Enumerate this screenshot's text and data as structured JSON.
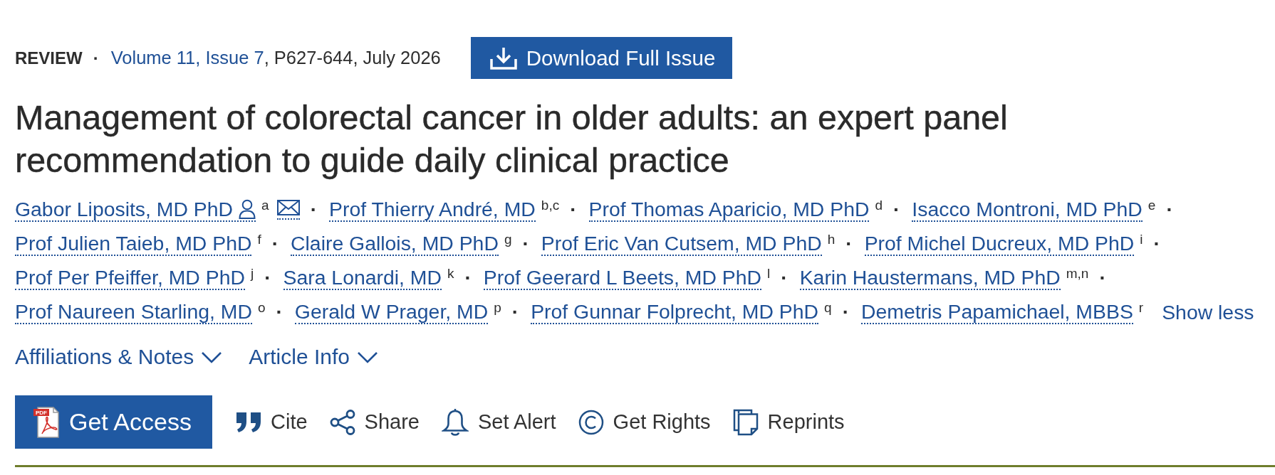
{
  "header": {
    "article_type": "REVIEW",
    "separator": "·",
    "issue_link": "Volume 11, Issue 7",
    "pages_date": ", P627-644, July 2026",
    "download_button": "Download Full Issue"
  },
  "title": "Management of colorectal cancer in older adults: an expert panel recommendation to guide daily clinical practice",
  "authors": [
    {
      "name": "Gabor Liposits, MD PhD",
      "affiliations": "a",
      "corresponding": true,
      "separator": "·"
    },
    {
      "name": "Prof Thierry André, MD",
      "affiliations": "b,c",
      "corresponding": false,
      "separator": "·"
    },
    {
      "name": "Prof Thomas Aparicio, MD PhD",
      "affiliations": "d",
      "corresponding": false,
      "separator": "·"
    },
    {
      "name": "Isacco Montroni, MD PhD",
      "affiliations": "e",
      "corresponding": false,
      "separator": "·"
    },
    {
      "name": "Prof Julien Taieb, MD PhD",
      "affiliations": "f",
      "corresponding": false,
      "separator": "·"
    },
    {
      "name": "Claire Gallois, MD PhD",
      "affiliations": "g",
      "corresponding": false,
      "separator": "·"
    },
    {
      "name": "Prof Eric Van Cutsem, MD PhD",
      "affiliations": "h",
      "corresponding": false,
      "separator": "·"
    },
    {
      "name": "Prof Michel Ducreux, MD PhD",
      "affiliations": "i",
      "corresponding": false,
      "separator": "·"
    },
    {
      "name": "Prof Per Pfeiffer, MD PhD",
      "affiliations": "j",
      "corresponding": false,
      "separator": "·"
    },
    {
      "name": "Sara Lonardi, MD",
      "affiliations": "k",
      "corresponding": false,
      "separator": "·"
    },
    {
      "name": "Prof Geerard L Beets, MD PhD",
      "affiliations": "l",
      "corresponding": false,
      "separator": "·"
    },
    {
      "name": "Karin Haustermans, MD PhD",
      "affiliations": "m,n",
      "corresponding": false,
      "separator": "·"
    },
    {
      "name": "Prof Naureen Starling, MD",
      "affiliations": "o",
      "corresponding": false,
      "separator": "·"
    },
    {
      "name": "Gerald W Prager, MD",
      "affiliations": "p",
      "corresponding": false,
      "separator": "·"
    },
    {
      "name": "Prof Gunnar Folprecht, MD PhD",
      "affiliations": "q",
      "corresponding": false,
      "separator": "·"
    },
    {
      "name": "Demetris Papamichael, MBBS",
      "affiliations": "r",
      "corresponding": false
    }
  ],
  "show_less": "Show less",
  "disclosures": [
    {
      "label": "Affiliations & Notes",
      "expanded": false
    },
    {
      "label": "Article Info",
      "expanded": false
    }
  ],
  "actions": {
    "access_button": "Get Access",
    "pdf_badge": "PDF",
    "items": [
      {
        "kind": "cite",
        "label": "Cite"
      },
      {
        "kind": "share",
        "label": "Share"
      },
      {
        "kind": "alert",
        "label": "Set Alert"
      },
      {
        "kind": "rights",
        "label": "Get Rights"
      },
      {
        "kind": "reprints",
        "label": "Reprints"
      }
    ]
  }
}
